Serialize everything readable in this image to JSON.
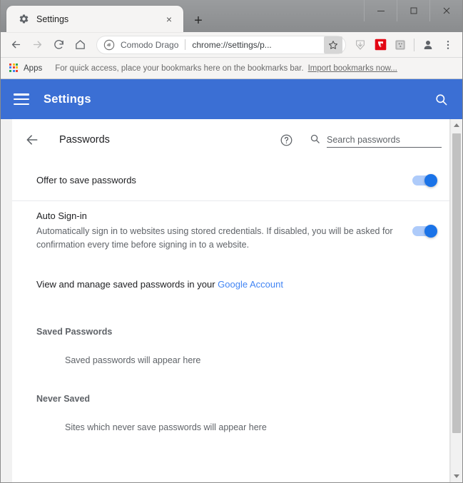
{
  "window": {
    "controls": {
      "minimize": "minimize-icon",
      "maximize": "maximize-icon",
      "close": "close-icon"
    }
  },
  "tabs": [
    {
      "title": "Settings",
      "favicon": "gear-icon",
      "close_label": "×",
      "active": true
    }
  ],
  "newtab_label": "+",
  "toolbar": {
    "back_icon": "back-arrow-icon",
    "forward_icon": "forward-arrow-icon",
    "reload_icon": "reload-icon",
    "home_icon": "home-icon",
    "omnibox": {
      "site_icon": "comodo-dragon-icon",
      "site_name": "Comodo Drago",
      "url": "chrome://settings/p...",
      "star_icon": "bookmark-star-icon"
    },
    "extensions": [
      {
        "name": "downloads-shield-icon"
      },
      {
        "name": "comodo-extension-icon"
      },
      {
        "name": "puzzle-extension-icon"
      }
    ],
    "profile_icon": "profile-avatar-icon",
    "menu_icon": "three-dot-menu-icon"
  },
  "bookmarks_bar": {
    "apps_label": "Apps",
    "hint": "For quick access, place your bookmarks here on the bookmarks bar.",
    "import_link": "Import bookmarks now...",
    "apps_colors": [
      "#ea4335",
      "#fbbc05",
      "#34a853",
      "#4285f4",
      "#ea4335",
      "#fbbc05",
      "#34a853",
      "#4285f4",
      "#ea4335"
    ]
  },
  "settings_header": {
    "menu_icon": "hamburger-menu-icon",
    "title": "Settings",
    "search_icon": "search-icon",
    "background_color": "#3b6fd4"
  },
  "page": {
    "back_icon": "back-arrow-icon",
    "title": "Passwords",
    "help_icon": "help-circle-icon",
    "search": {
      "icon": "search-icon",
      "placeholder": "Search passwords",
      "value": ""
    },
    "settings": [
      {
        "label": "Offer to save passwords",
        "description": "",
        "toggle_on": true,
        "toggle_name": "offer-to-save-passwords-toggle"
      },
      {
        "label": "Auto Sign-in",
        "description": "Automatically sign in to websites using stored credentials. If disabled, you will be asked for confirmation every time before signing in to a website.",
        "toggle_on": true,
        "toggle_name": "auto-sign-in-toggle"
      }
    ],
    "manage_text_prefix": "View and manage saved passwords in your ",
    "manage_link": "Google Account",
    "sections": [
      {
        "title": "Saved Passwords",
        "empty_text": "Saved passwords will appear here"
      },
      {
        "title": "Never Saved",
        "empty_text": "Sites which never save passwords will appear here"
      }
    ],
    "accent_color": "#1a73e8",
    "link_color": "#4285f4"
  }
}
